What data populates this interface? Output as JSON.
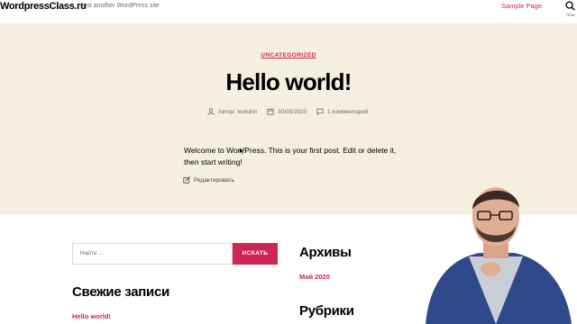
{
  "header": {
    "site_title": "WordpressClass.ru",
    "tagline": "Just another WordPress site",
    "nav": [
      "Sample Page"
    ],
    "search_label": "Поис"
  },
  "post": {
    "category": "UNCATEGORIZED",
    "title": "Hello world!",
    "author": "Автор: leolukin",
    "date": "30/05/2020",
    "comments": "1 комментарий",
    "content": "Welcome to WordPress. This is your first post. Edit or delete it, then start writing!",
    "edit_label": "Редактировать"
  },
  "widgets": {
    "search": {
      "placeholder": "Найти ...",
      "button": "ИСКАТЬ"
    },
    "recent": {
      "title": "Свежие записи",
      "items": [
        "Hello world!"
      ]
    },
    "archive": {
      "title": "Архивы",
      "items": [
        "Май 2020"
      ]
    },
    "rubrics": {
      "title": "Рубрики"
    }
  },
  "colors": {
    "accent": "#cd2653",
    "hero_bg": "#f5efe0"
  }
}
